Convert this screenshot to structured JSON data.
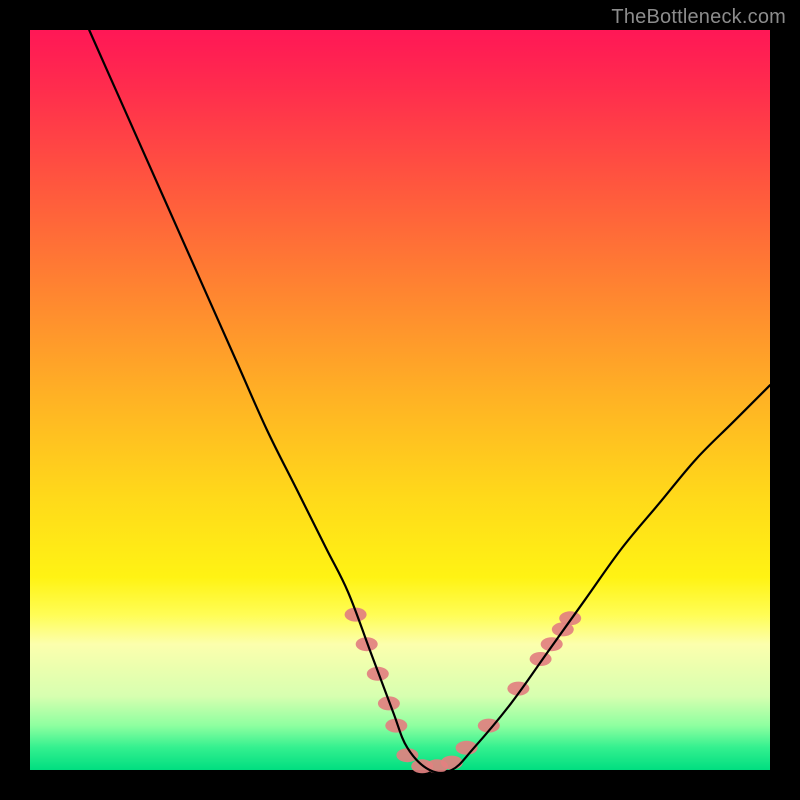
{
  "watermark": "TheBottleneck.com",
  "chart_data": {
    "type": "line",
    "title": "",
    "xlabel": "",
    "ylabel": "",
    "xlim": [
      0,
      100
    ],
    "ylim": [
      0,
      100
    ],
    "series": [
      {
        "name": "curve",
        "x": [
          8,
          12,
          16,
          20,
          24,
          28,
          32,
          36,
          40,
          43,
          46,
          49,
          51,
          54,
          57,
          60,
          65,
          70,
          75,
          80,
          85,
          90,
          95,
          100
        ],
        "values": [
          100,
          91,
          82,
          73,
          64,
          55,
          46,
          38,
          30,
          24,
          16,
          8,
          3,
          0,
          0,
          3,
          9,
          16,
          23,
          30,
          36,
          42,
          47,
          52
        ]
      }
    ],
    "markers": {
      "comment": "salmon capsule markers scattered near valley and on right branch",
      "points": [
        {
          "x": 44,
          "y": 21
        },
        {
          "x": 45.5,
          "y": 17
        },
        {
          "x": 47,
          "y": 13
        },
        {
          "x": 48.5,
          "y": 9
        },
        {
          "x": 49.5,
          "y": 6
        },
        {
          "x": 51,
          "y": 2
        },
        {
          "x": 53,
          "y": 0.5
        },
        {
          "x": 55,
          "y": 0.5
        },
        {
          "x": 57,
          "y": 1
        },
        {
          "x": 59,
          "y": 3
        },
        {
          "x": 62,
          "y": 6
        },
        {
          "x": 66,
          "y": 11
        },
        {
          "x": 69,
          "y": 15
        },
        {
          "x": 70.5,
          "y": 17
        },
        {
          "x": 72,
          "y": 19
        },
        {
          "x": 73,
          "y": 20.5
        }
      ],
      "color": "#e28080",
      "rx": 11,
      "ry": 7
    }
  }
}
